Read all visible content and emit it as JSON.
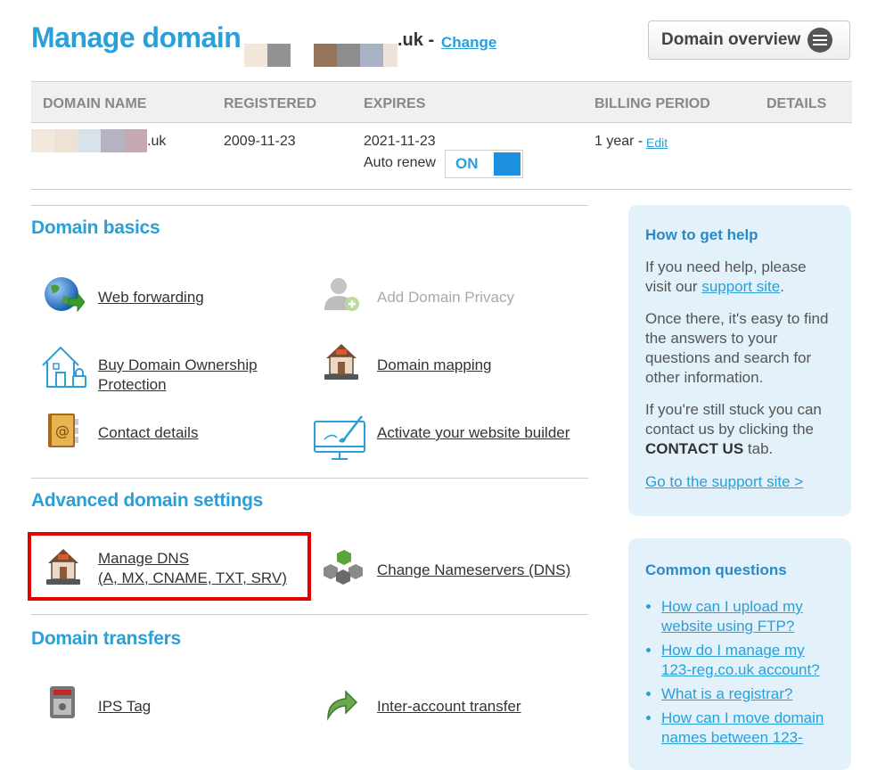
{
  "header": {
    "title": "Manage domain",
    "tld": ".uk -",
    "change_label": "Change",
    "overview_label": "Domain overview"
  },
  "table": {
    "columns": [
      "DOMAIN NAME",
      "REGISTERED",
      "EXPIRES",
      "BILLING PERIOD",
      "DETAILS"
    ],
    "row": {
      "domain_suffix": ".uk",
      "registered": "2009-11-23",
      "expires": "2021-11-23",
      "auto_renew_label": "Auto renew",
      "auto_renew_state": "ON",
      "billing_period": "1 year -",
      "edit_label": "Edit"
    }
  },
  "sections": {
    "basics": {
      "title": "Domain basics",
      "items": [
        {
          "label": "Web forwarding",
          "icon": "globe-arrow-icon"
        },
        {
          "label": "Add Domain Privacy",
          "icon": "user-plus-icon",
          "disabled": true
        },
        {
          "label": "Buy Domain Ownership Protection",
          "icon": "house-lock-icon"
        },
        {
          "label": "Domain mapping",
          "icon": "house-server-icon"
        },
        {
          "label": "Contact details",
          "icon": "address-book-icon"
        },
        {
          "label": "Activate your website builder",
          "icon": "monitor-brush-icon"
        }
      ]
    },
    "advanced": {
      "title": "Advanced domain settings",
      "items": [
        {
          "label_line1": "Manage DNS",
          "label_line2": "(A, MX, CNAME, TXT, SRV)",
          "icon": "house-server-icon"
        },
        {
          "label": "Change Nameservers (DNS)",
          "icon": "network-cubes-icon"
        }
      ]
    },
    "transfers": {
      "title": "Domain transfers",
      "items": [
        {
          "label": "IPS Tag",
          "icon": "server-lock-icon"
        },
        {
          "label": "Inter-account transfer",
          "icon": "green-arrow-icon"
        }
      ]
    }
  },
  "sidebar": {
    "help": {
      "title": "How to get help",
      "p1_before": "If you need help, please visit our",
      "p1_link": "support site",
      "p1_after": ".",
      "p2": "Once there, it's easy to find the answers to your questions and search for other information.",
      "p3_before": "If you're still stuck you can contact us by clicking the",
      "p3_bold": "CONTACT US",
      "p3_after": "tab.",
      "support_link": "Go to the support site >"
    },
    "questions": {
      "title": "Common questions",
      "items": [
        "How can I upload my website using FTP?",
        "How do I manage my 123-reg.co.uk account?",
        "What is a registrar?",
        "How can I move domain names between 123-"
      ]
    }
  },
  "colors": {
    "brand_blue": "#2a9fd8",
    "highlight_red": "#e00000",
    "toggle_blue": "#1e90e0",
    "sidebar_bg": "#e2f1fa"
  }
}
